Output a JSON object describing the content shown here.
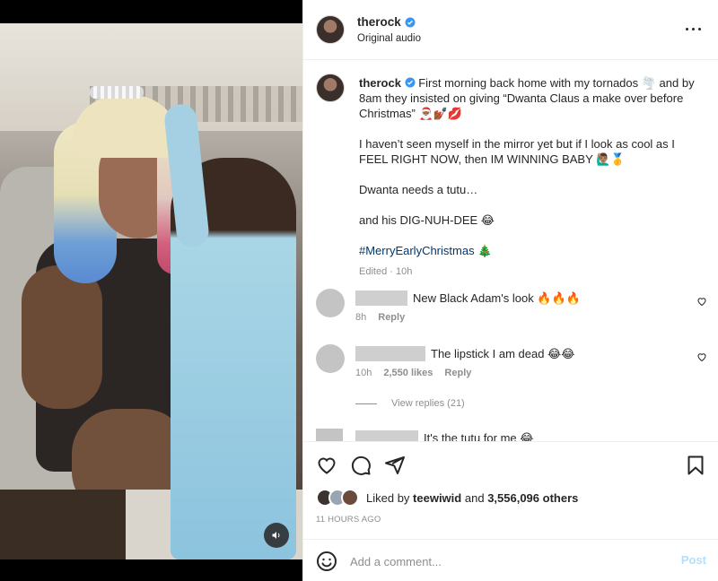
{
  "post": {
    "username": "therock",
    "audio": "Original audio"
  },
  "caption": {
    "username": "therock",
    "line1": "First morning back home with my tornados 🌪️ and by 8am they insisted on giving “Dwanta Claus a make over before Christmas” 🎅🏾💅🏾💋",
    "line2": "I haven’t seen myself in the mirror yet but if I look as cool as I FEEL RIGHT NOW, then IM WINNING BABY 🙋🏽‍♂️🥇",
    "line3": "Dwanta needs a tutu…",
    "line4": "and his DIG-NUH-DEE 😂",
    "hashtag": "#MerryEarlyChristmas",
    "hashtag_emoji": "🎄",
    "edited": "Edited · 10h"
  },
  "comments": [
    {
      "text": "New Black Adam's look 🔥🔥🔥",
      "time": "8h",
      "likes": "",
      "reply": "Reply"
    },
    {
      "text": "The lipstick I am dead 😂😂",
      "time": "10h",
      "likes": "2,550 likes",
      "reply": "Reply"
    },
    {
      "text": "It's the tutu for me 😂"
    }
  ],
  "view_replies": "View replies (21)",
  "likes": {
    "prefix": "Liked by",
    "user": "teewiwid",
    "middle": "and",
    "count": "3,556,096 others"
  },
  "timestamp": "11 HOURS AGO",
  "composer": {
    "placeholder": "Add a comment...",
    "post_label": "Post"
  },
  "colors": {
    "verified": "#3897f0",
    "link": "#00376b",
    "post_disabled": "#b2dffc"
  },
  "icons": {
    "heart": "heart-icon",
    "comment": "comment-icon",
    "share": "paper-plane-icon",
    "save": "bookmark-icon",
    "emoji": "smiley-icon",
    "sound": "speaker-icon",
    "more": "ellipsis-icon"
  }
}
